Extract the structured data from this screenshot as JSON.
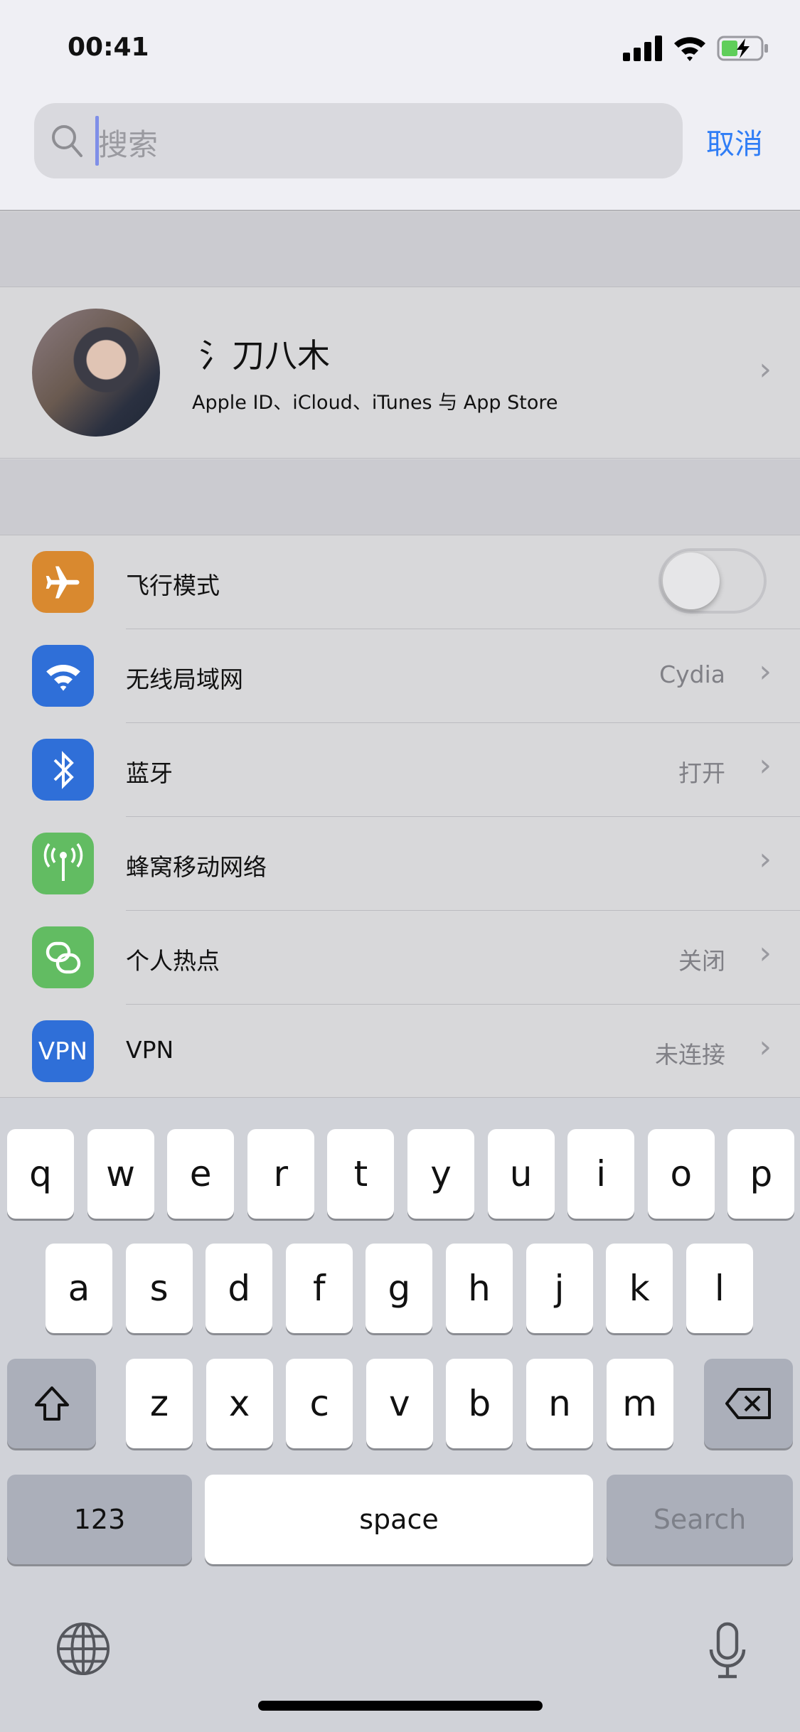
{
  "status_bar": {
    "time": "00:41",
    "icons": [
      "signal-icon",
      "wifi-icon",
      "battery-charging-icon"
    ]
  },
  "search": {
    "placeholder": "搜索",
    "cancel_label": "取消"
  },
  "profile": {
    "name": "氵刀八木",
    "subtitle": "Apple ID、iCloud、iTunes 与 App Store"
  },
  "settings": [
    {
      "label": "飞行模式",
      "icon": "airplane-icon",
      "color": "#d9892f",
      "toggle": false
    },
    {
      "label": "无线局域网",
      "icon": "wifi-icon",
      "color": "#2f6fd8",
      "value": "Cydia"
    },
    {
      "label": "蓝牙",
      "icon": "bluetooth-icon",
      "color": "#2f6fd8",
      "value": "打开"
    },
    {
      "label": "蜂窝移动网络",
      "icon": "antenna-icon",
      "color": "#62bc62",
      "value": ""
    },
    {
      "label": "个人热点",
      "icon": "hotspot-icon",
      "color": "#62bc62",
      "value": "关闭"
    },
    {
      "label": "VPN",
      "icon": "vpn-icon",
      "icon_text": "VPN",
      "color": "#2f6fd8",
      "value": "未连接"
    }
  ],
  "keyboard": {
    "row1": [
      "q",
      "w",
      "e",
      "r",
      "t",
      "y",
      "u",
      "i",
      "o",
      "p"
    ],
    "row2": [
      "a",
      "s",
      "d",
      "f",
      "g",
      "h",
      "j",
      "k",
      "l"
    ],
    "row3": [
      "z",
      "x",
      "c",
      "v",
      "b",
      "n",
      "m"
    ],
    "numbers_label": "123",
    "space_label": "space",
    "search_label": "Search"
  },
  "colors": {
    "accent": "#2f7df6"
  }
}
